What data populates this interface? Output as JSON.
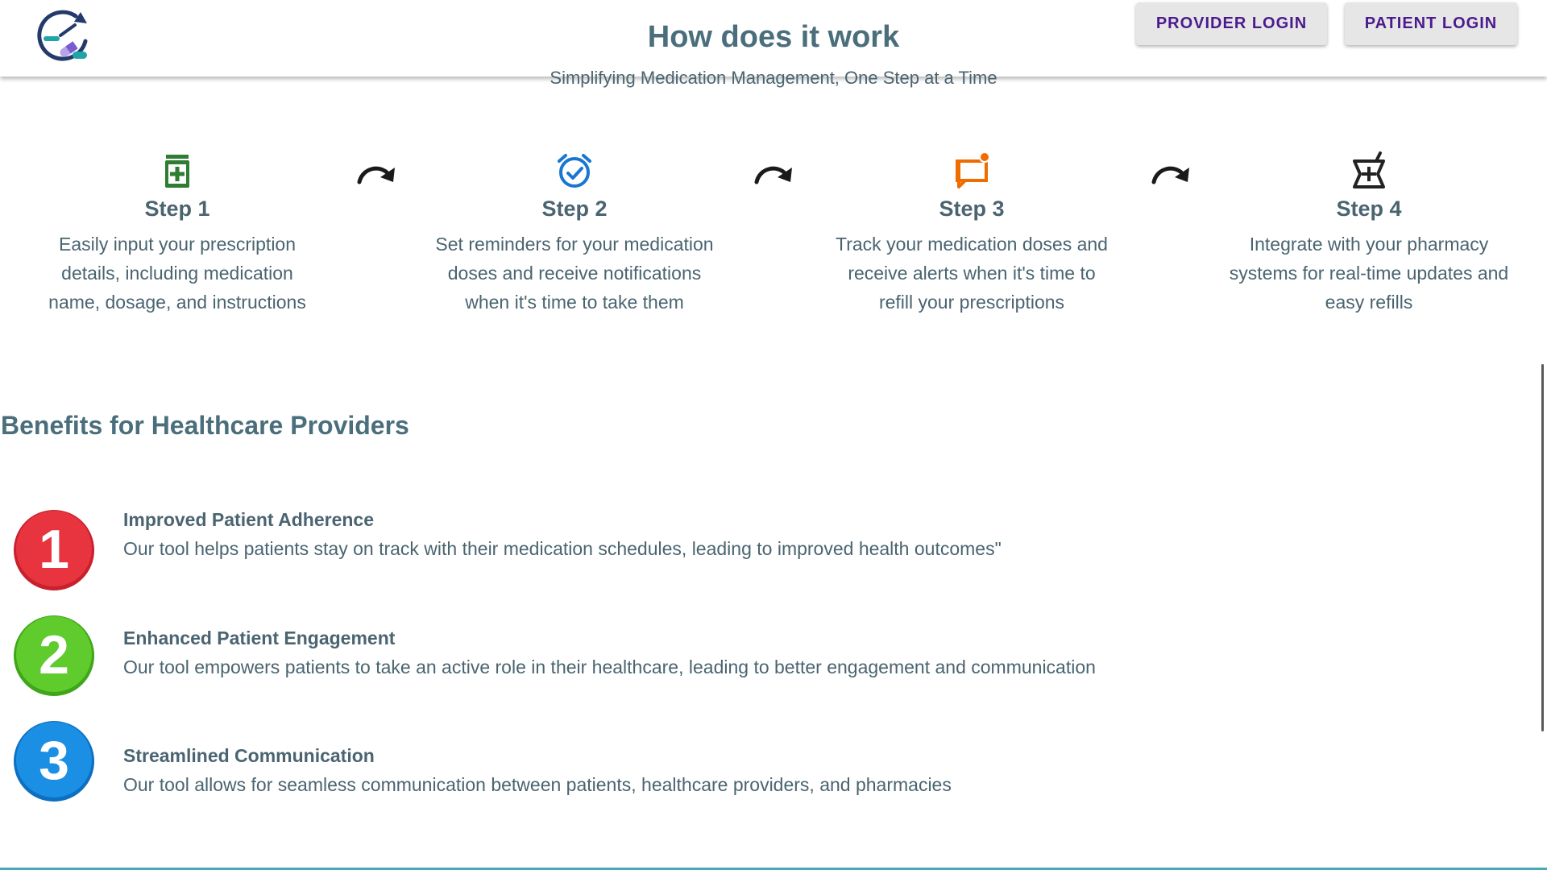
{
  "header": {
    "logo_icon": "medication-clock-logo",
    "provider_login_label": "PROVIDER LOGIN",
    "patient_login_label": "PATIENT LOGIN"
  },
  "hero": {
    "title": "How does it work",
    "subtitle": "Simplifying Medication Management, One Step at a Time"
  },
  "steps": [
    {
      "icon": "medication-bottle-icon",
      "icon_color": "#2e7d32",
      "title": "Step 1",
      "lines": [
        "Easily input your prescription",
        "details, including medication",
        "name, dosage, and instructions"
      ]
    },
    {
      "icon": "alarm-clock-check-icon",
      "icon_color": "#1976d2",
      "title": "Step 2",
      "lines": [
        "Set reminders for your medication",
        "doses and receive notifications",
        "when it's time to take them"
      ]
    },
    {
      "icon": "chat-notification-icon",
      "icon_color": "#ef6c00",
      "title": "Step 3",
      "lines": [
        "Track your medication doses and",
        "receive alerts when it's time to",
        "refill your prescriptions"
      ]
    },
    {
      "icon": "pharmacy-icon",
      "icon_color": "#222222",
      "title": "Step 4",
      "lines": [
        "Integrate with your pharmacy",
        "systems for real-time updates and",
        "easy refills"
      ]
    }
  ],
  "benefits": {
    "heading": "Benefits for Healthcare Providers",
    "items": [
      {
        "number": "1",
        "badge_color": "#e8343f",
        "title": "Improved Patient Adherence",
        "description": "Our tool helps patients stay on track with their medication schedules, leading to improved health outcomes\""
      },
      {
        "number": "2",
        "badge_color": "#5fcb2c",
        "title": "Enhanced Patient Engagement",
        "description": "Our tool empowers patients to take an active role in their healthcare, leading to better engagement and communication"
      },
      {
        "number": "3",
        "badge_color": "#1a8fe3",
        "title": "Streamlined Communication",
        "description": "Our tool allows for seamless communication between patients, healthcare providers, and pharmacies"
      }
    ]
  }
}
